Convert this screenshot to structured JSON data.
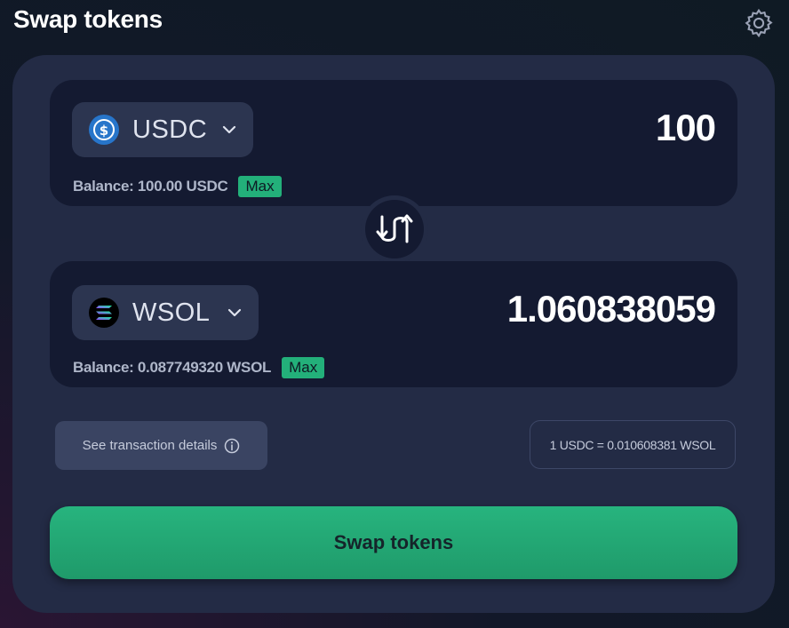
{
  "header": {
    "title": "Swap tokens",
    "settings_icon": "gear-icon"
  },
  "from": {
    "symbol": "USDC",
    "icon": "usdc-icon",
    "amount": "100",
    "balance": "Balance: 100.00 USDC",
    "max_label": "Max"
  },
  "to": {
    "symbol": "WSOL",
    "icon": "solana-icon",
    "amount": "1.060838059",
    "balance": "Balance: 0.087749320 WSOL",
    "max_label": "Max"
  },
  "details": {
    "label": "See transaction details",
    "icon": "info-icon"
  },
  "rate": "1 USDC = 0.010608381 WSOL",
  "swap_button": "Swap tokens",
  "colors": {
    "accent": "#23b07a",
    "card": "#232b45",
    "panel": "#141a31",
    "usdc": "#2775ca"
  }
}
